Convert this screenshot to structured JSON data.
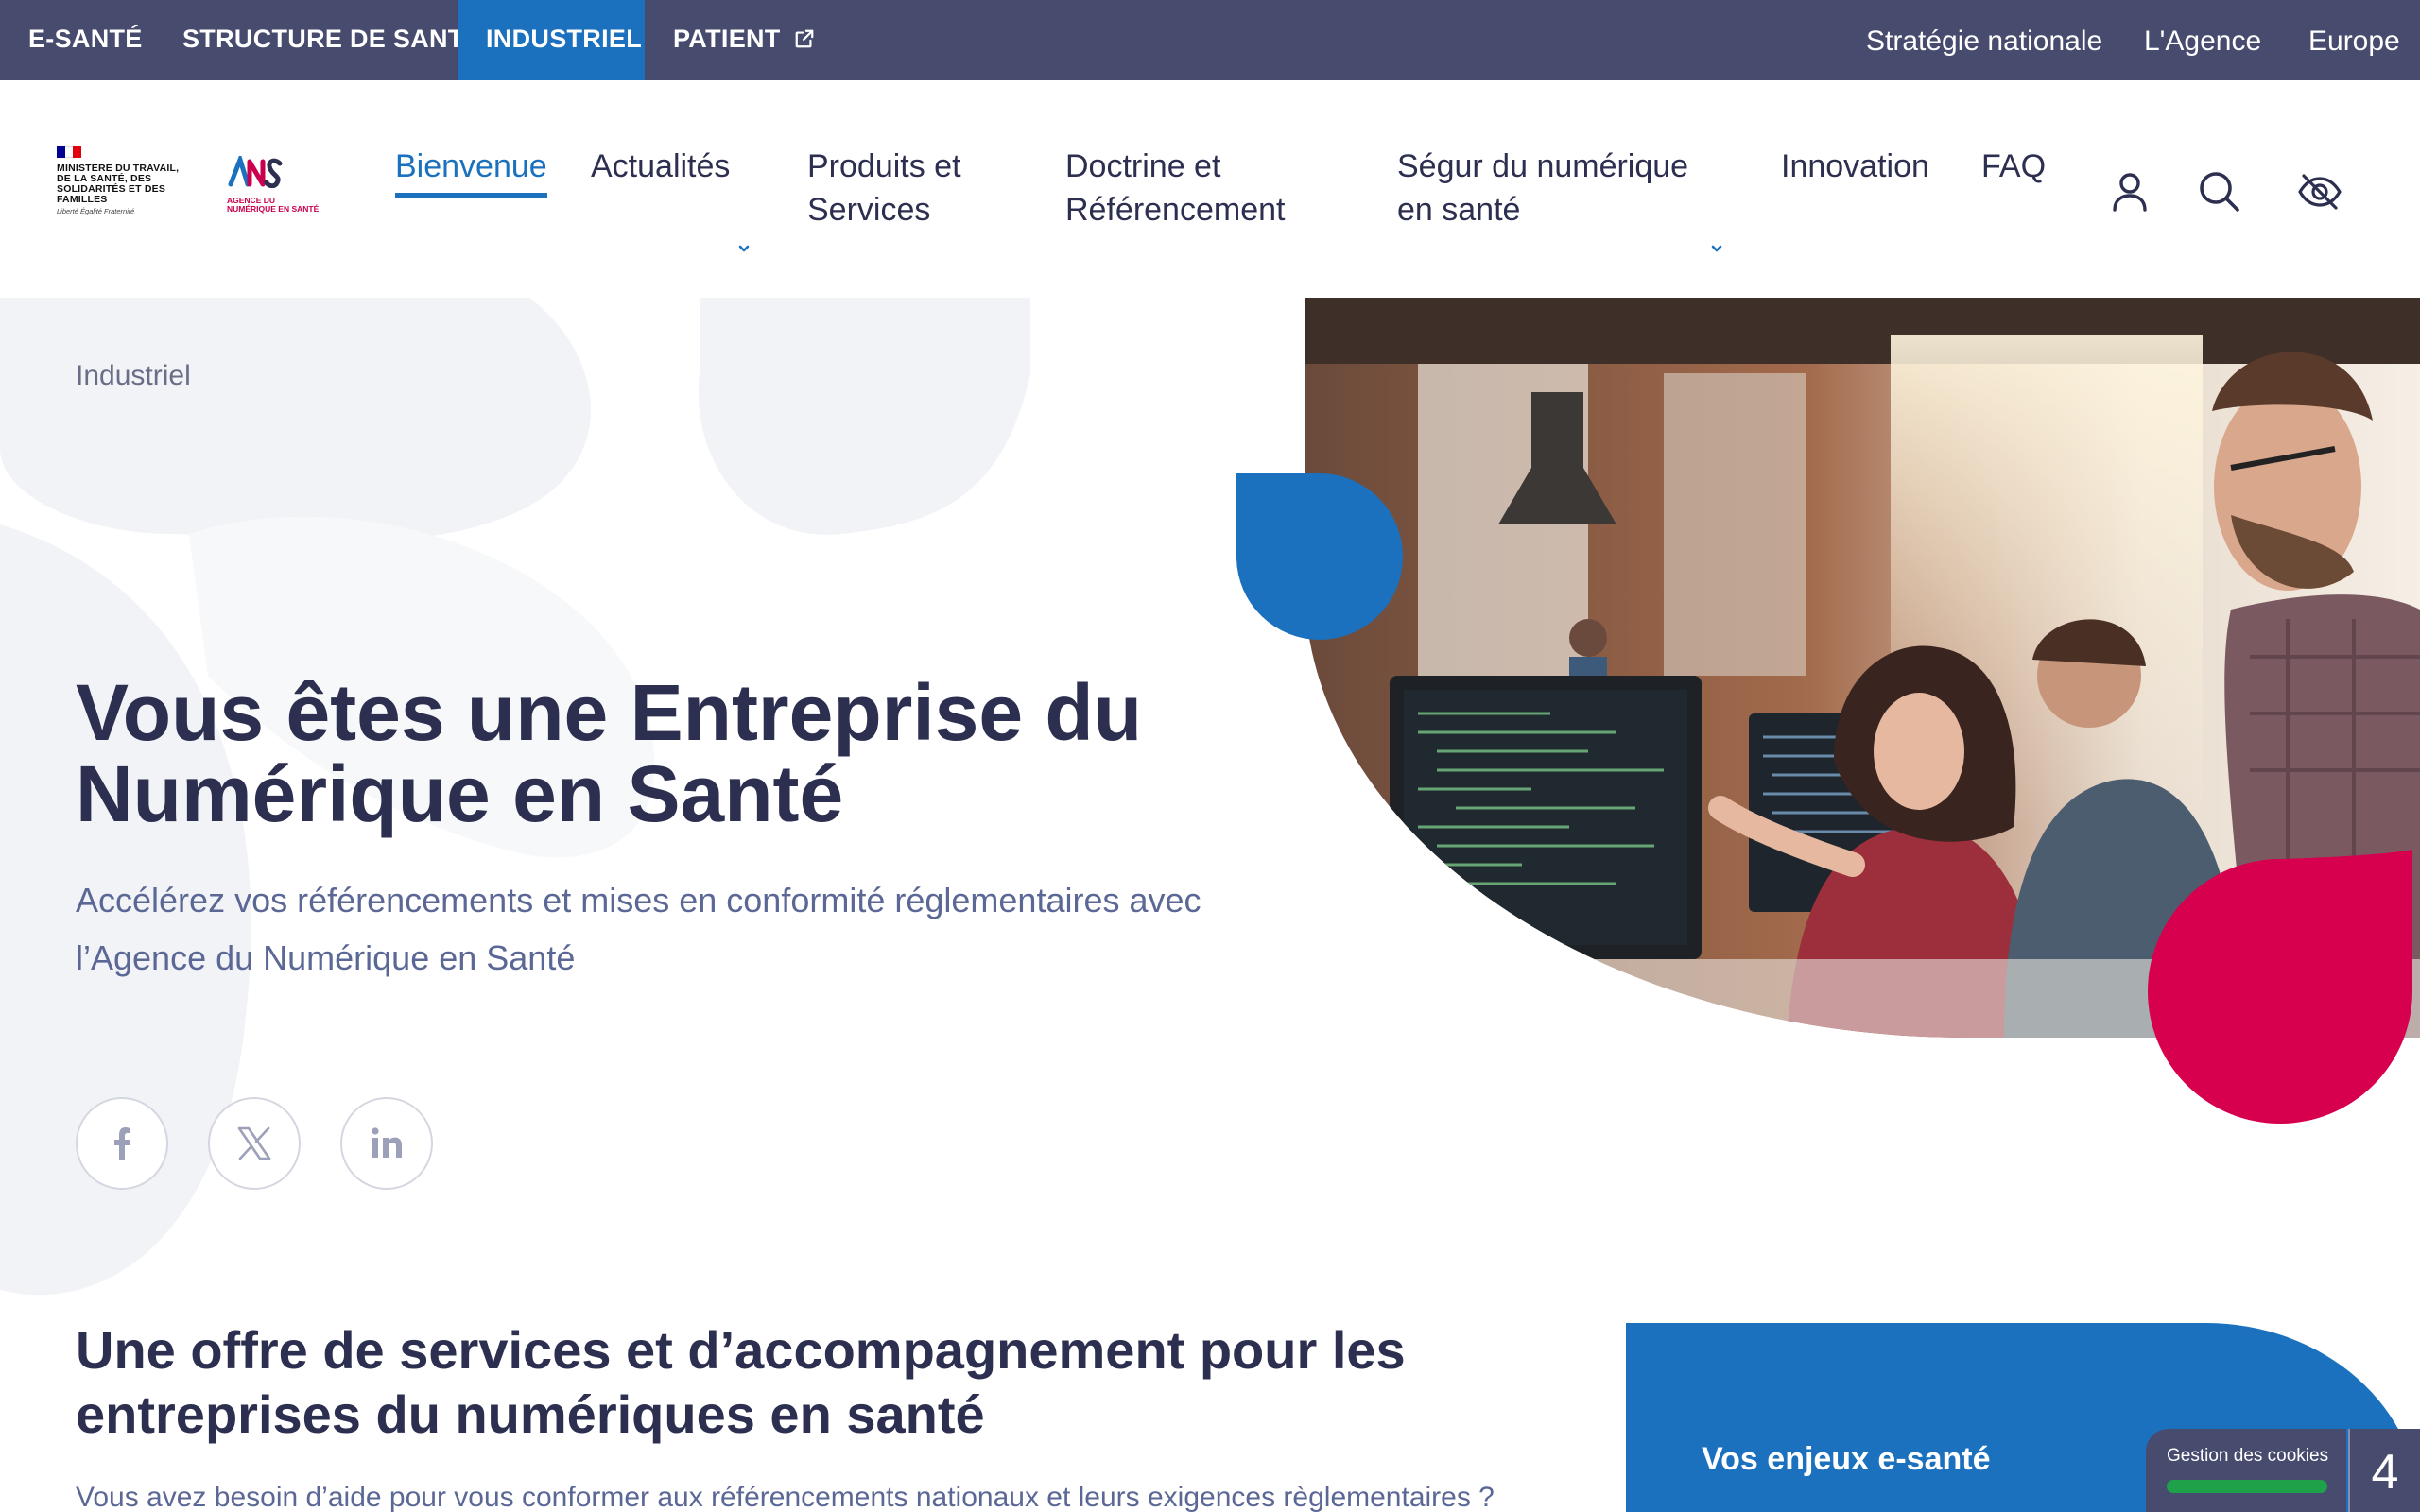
{
  "topbar": {
    "tabs": [
      {
        "label": "E-SANTÉ"
      },
      {
        "label": "STRUCTURE DE SANTÉ"
      },
      {
        "label": "INDUSTRIEL",
        "active": true
      },
      {
        "label": "PATIENT",
        "icon": "external-link-icon"
      }
    ],
    "utility_links": [
      "Stratégie nationale",
      "L'Agence",
      "Europe"
    ]
  },
  "header": {
    "ministry_logo": {
      "text": "MINISTÈRE DU TRAVAIL, DE LA SANTÉ, DES SOLIDARITÉS ET DES FAMILLES",
      "motto": "Liberté Égalité Fraternité"
    },
    "ans_logo": {
      "monogram": "ANS",
      "text": "AGENCE DU NUMÉRIQUE EN SANTÉ"
    },
    "nav": [
      {
        "label": "Bienvenue",
        "active": true
      },
      {
        "label": "Actualités",
        "has_dropdown": true
      },
      {
        "label": "Produits et Services"
      },
      {
        "label": "Doctrine et Référencement"
      },
      {
        "label": "Ségur du numérique en santé",
        "has_dropdown": true
      },
      {
        "label": "Innovation"
      },
      {
        "label": "FAQ"
      }
    ],
    "icons": [
      "user-icon",
      "search-icon",
      "accessibility-eye-icon"
    ]
  },
  "hero": {
    "breadcrumb": "Industriel",
    "title": "Vous êtes une Entreprise du Numérique en Santé",
    "subtitle": "Accélérez vos référencements et mises en conformité réglementaires avec l’Agence du Numérique en Santé",
    "social": [
      "facebook-icon",
      "x-icon",
      "linkedin-icon"
    ]
  },
  "section": {
    "title": "Une offre de services et d’accompagnement pour les entreprises du numériques en santé",
    "text": "Vous avez besoin d’aide pour vous conformer aux référencements nationaux et leurs exigences règlementaires ?"
  },
  "card": {
    "title": "Vos enjeux e-santé"
  },
  "cookie_widget": {
    "label": "Gestion des cookies",
    "number": "4"
  },
  "colors": {
    "topbar_bg": "#474b6e",
    "accent_blue": "#1b71be",
    "accent_red": "#d6004f",
    "heading": "#2c2f4f",
    "subtitle": "#5b6795",
    "cookie_green": "#1fa14a"
  }
}
